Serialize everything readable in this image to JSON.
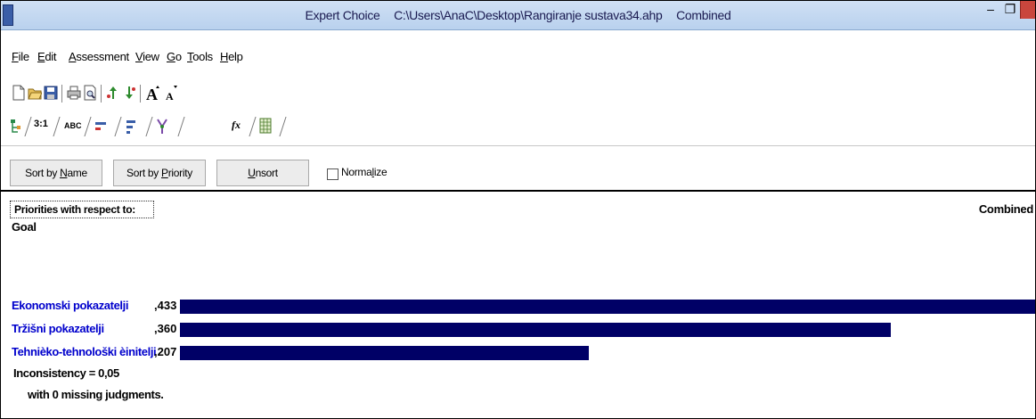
{
  "window": {
    "app_name": "Expert Choice",
    "file_path": "C:\\Users\\AnaC\\Desktop\\Rangiranje sustava34.ahp",
    "view_name": "Combined",
    "minimize_glyph": "–",
    "restore_glyph": "❐"
  },
  "menu": [
    {
      "label": "File",
      "key": "F"
    },
    {
      "label": "Edit",
      "key": "E"
    },
    {
      "label": "Assessment",
      "key": "A"
    },
    {
      "label": "View",
      "key": "V"
    },
    {
      "label": "Go",
      "key": "G"
    },
    {
      "label": "Tools",
      "key": "T"
    },
    {
      "label": "Help",
      "key": "H"
    }
  ],
  "toolbar_icons": [
    "new-file-icon",
    "open-folder-icon",
    "save-icon",
    "print-icon",
    "print-preview-icon",
    "move-up-icon",
    "move-down-icon",
    "font-increase-icon",
    "font-decrease-icon"
  ],
  "tabs": {
    "pairwise_label": "3:1",
    "verbal_label": "ABC",
    "formula_label": "fx"
  },
  "buttons": {
    "sort_name": {
      "label": "Sort by Name",
      "underline": "N"
    },
    "sort_priority": {
      "label": "Sort by Priority",
      "underline": "P"
    },
    "unsort": {
      "label": "Unsort",
      "underline": "U"
    },
    "normalize": {
      "label": "Normalize",
      "underline": "l",
      "checked": false
    }
  },
  "priorities": {
    "header": "Priorities with respect to:",
    "mode": "Combined",
    "goal": "Goal",
    "items": [
      {
        "name": "Ekonomski pokazatelji",
        "value_text": ",433",
        "value": 0.433
      },
      {
        "name": "Tržišni pokazatelji",
        "value_text": ",360",
        "value": 0.36
      },
      {
        "name": "Tehnièko-tehnološki èinitelji",
        "value_text": ",207",
        "value": 0.207
      }
    ],
    "inconsistency": "Inconsistency = 0,05",
    "missing": "with 0  missing judgments."
  },
  "colors": {
    "bar": "#000066",
    "label": "#0000cc",
    "titlebar": "#c6dbf3",
    "close": "#c9463d"
  }
}
